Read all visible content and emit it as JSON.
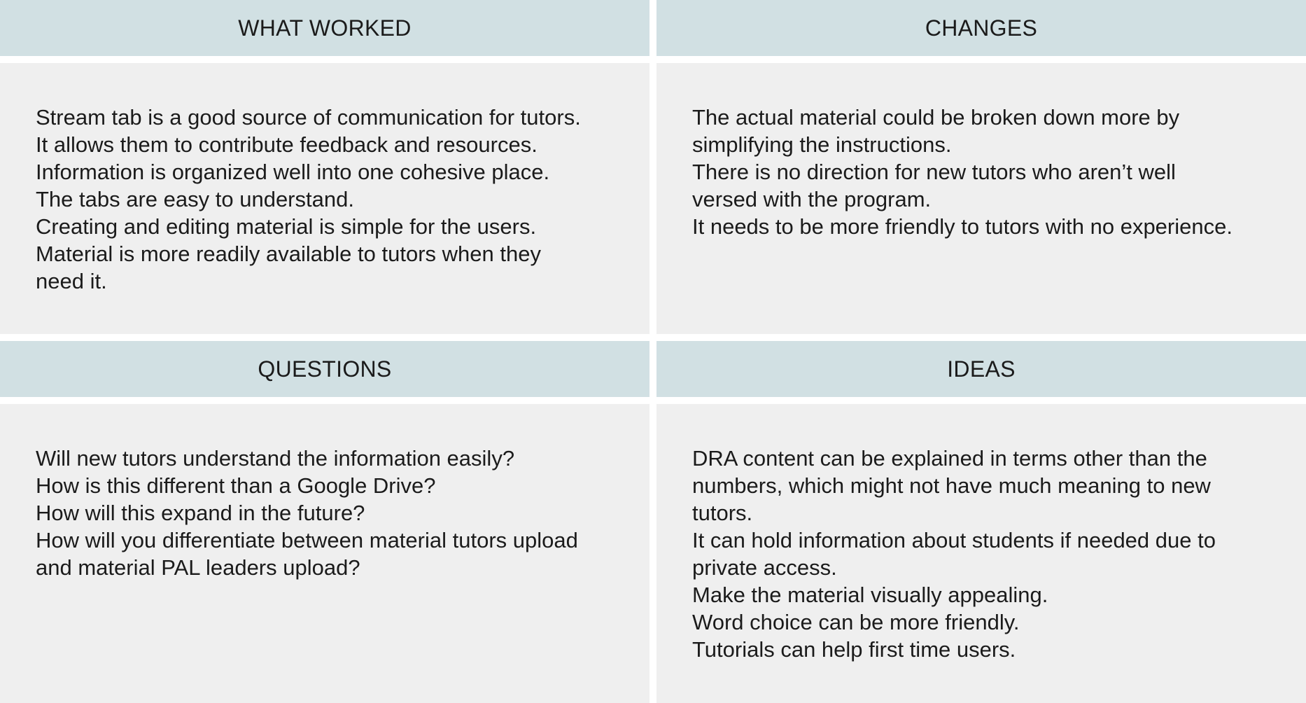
{
  "what_worked": {
    "title": "WHAT WORKED",
    "lines": [
      "Stream tab is a good source of communication for tutors.",
      "It allows them to contribute feedback and resources.",
      "Information is organized well into one cohesive place.",
      "The tabs are easy to understand.",
      "Creating and editing material is simple for the users.",
      "Material is more readily available to tutors when they need it."
    ]
  },
  "changes": {
    "title": "CHANGES",
    "lines": [
      "The actual material could be broken down more by simplifying the instructions.",
      "There is no direction for new tutors who aren’t well versed with the program.",
      "It needs to be more friendly to tutors with no experience."
    ]
  },
  "questions": {
    "title": "QUESTIONS",
    "lines": [
      "Will new tutors understand the information easily?",
      "How is this different than a Google Drive?",
      "How will this expand in the future?",
      "How will you differentiate between material tutors upload and material PAL leaders upload?"
    ]
  },
  "ideas": {
    "title": "IDEAS",
    "lines": [
      "DRA content can be explained in terms other than the numbers, which might not have much meaning to new tutors.",
      "It can hold information about students if needed due to private access.",
      "Make the material visually appealing.",
      "Word choice can be more friendly.",
      "Tutorials can help first time users."
    ]
  },
  "colors": {
    "header_bg": "#d1e0e3",
    "body_bg": "#efefef",
    "text": "#1b1b1b"
  }
}
